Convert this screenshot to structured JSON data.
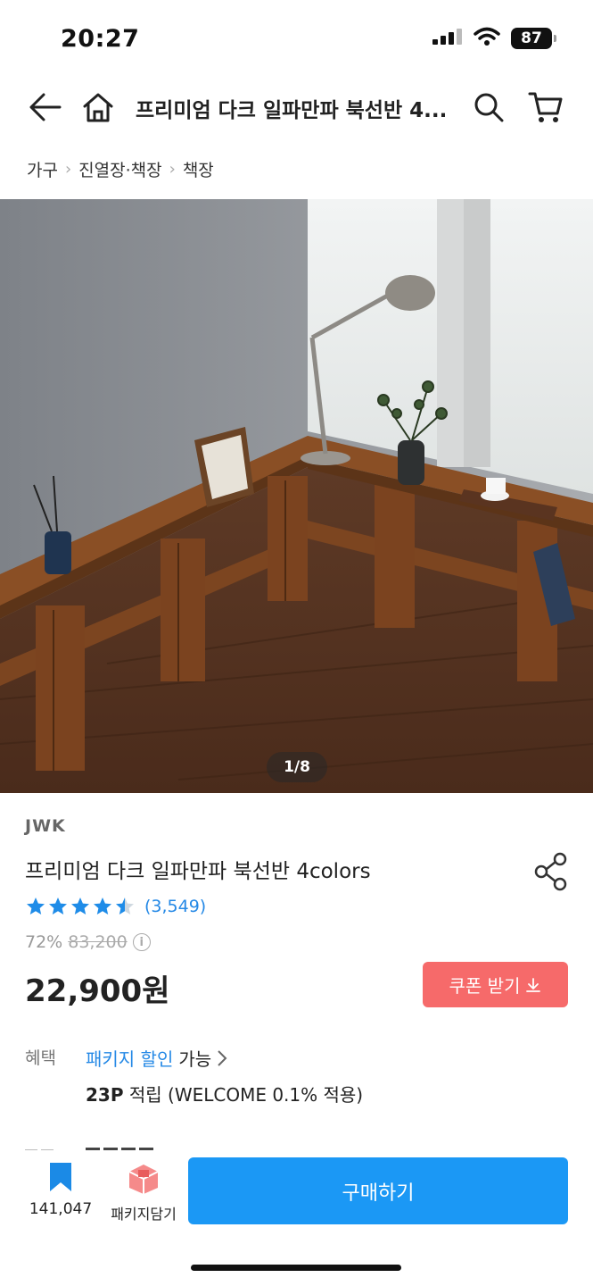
{
  "status": {
    "time": "20:27",
    "battery": "87"
  },
  "nav": {
    "title": "프리미엄 다크 일파만파 북선반 4..."
  },
  "breadcrumb": [
    "가구",
    "진열장·책장",
    "책장"
  ],
  "gallery": {
    "counter": "1/8"
  },
  "product": {
    "brand": "JWK",
    "name": "프리미엄 다크 일파만파 북선반 4colors",
    "rating": 4.5,
    "rating_count": "(3,549)",
    "discount": "72%",
    "original_price": "83,200",
    "price": "22,900원"
  },
  "coupon": {
    "label": "쿠폰 받기"
  },
  "benefit": {
    "label": "혜택",
    "link": "패키지 할인",
    "suffix": "가능",
    "points": "23P",
    "points_suffix": "적립 (WELCOME 0.1% 적용)"
  },
  "bottom": {
    "wish_count": "141,047",
    "package_label": "패키지담기",
    "buy_label": "구매하기"
  },
  "colors": {
    "accent": "#1b98f5",
    "coupon": "#f66a6a",
    "link": "#2589e6"
  }
}
